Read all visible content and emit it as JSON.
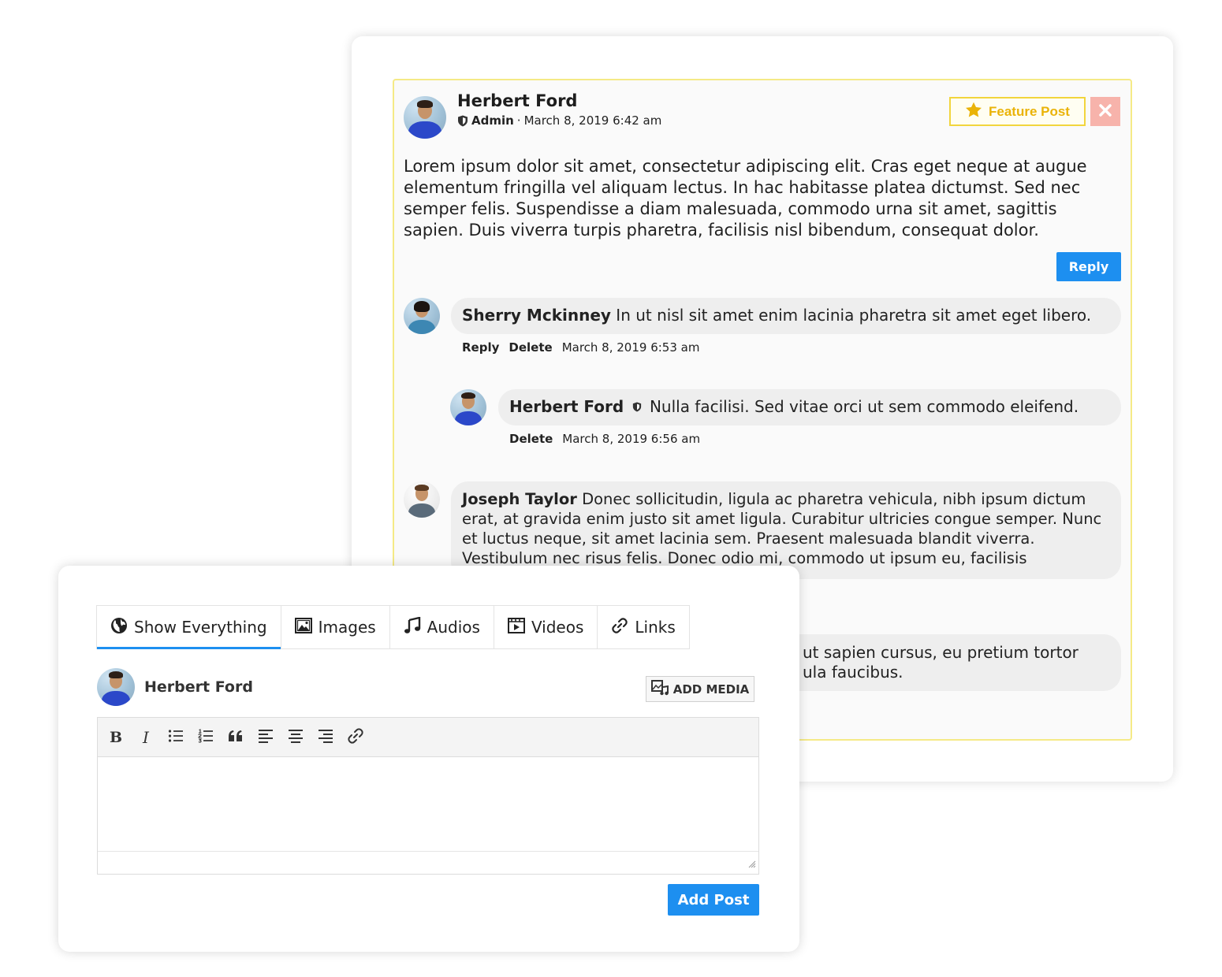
{
  "post": {
    "author": "Herbert Ford",
    "role": "Admin",
    "separator": "·",
    "timestamp": "March 8, 2019 6:42 am",
    "feature_label": "Feature Post",
    "body": "Lorem ipsum dolor sit amet, consectetur adipiscing elit. Cras eget neque at augue elementum fringilla vel aliquam lectus. In hac habitasse platea dictumst. Sed nec semper felis. Suspendisse a diam malesuada, commodo urna sit amet, sagittis sapien. Duis viverra turpis pharetra, facilisis nisl bibendum, consequat dolor.",
    "reply_label": "Reply"
  },
  "comments": [
    {
      "author": "Sherry Mckinney",
      "text": "In ut nisl sit amet enim lacinia pharetra sit amet eget libero.",
      "reply_label": "Reply",
      "delete_label": "Delete",
      "timestamp": "March 8, 2019 6:53 am"
    },
    {
      "author": "Herbert Ford",
      "text": "Nulla facilisi. Sed vitae orci ut sem commodo eleifend.",
      "delete_label": "Delete",
      "timestamp": "March 8, 2019 6:56 am"
    },
    {
      "author": "Joseph Taylor",
      "text": "Donec sollicitudin, ligula ac pharetra vehicula, nibh ipsum dictum erat, at gravida enim justo sit amet ligula. Curabitur ultricies congue semper. Nunc et luctus neque, sit amet lacinia sem. Praesent malesuada blandit viverra. Vestibulum nec risus felis. Donec odio mi, commodo ut ipsum eu, facilisis consectetur felis."
    },
    {
      "text": "ut sapien cursus, eu pretium tortor ula faucibus."
    }
  ],
  "composer": {
    "tabs": [
      {
        "label": "Show Everything",
        "icon": "globe-icon"
      },
      {
        "label": "Images",
        "icon": "image-icon"
      },
      {
        "label": "Audios",
        "icon": "music-icon"
      },
      {
        "label": "Videos",
        "icon": "video-icon"
      },
      {
        "label": "Links",
        "icon": "link-icon"
      }
    ],
    "active_tab": "Show Everything",
    "author": "Herbert Ford",
    "add_media_label": "ADD MEDIA",
    "toolbar": {
      "bold": "B",
      "italic": "I"
    },
    "editor_value": "",
    "submit_label": "Add Post"
  },
  "colors": {
    "accent": "#1d8ff0",
    "feature": "#eab308",
    "feature_border": "#f2d53d",
    "post_border": "#f5ea86",
    "close_bg": "#f7b3ab"
  }
}
